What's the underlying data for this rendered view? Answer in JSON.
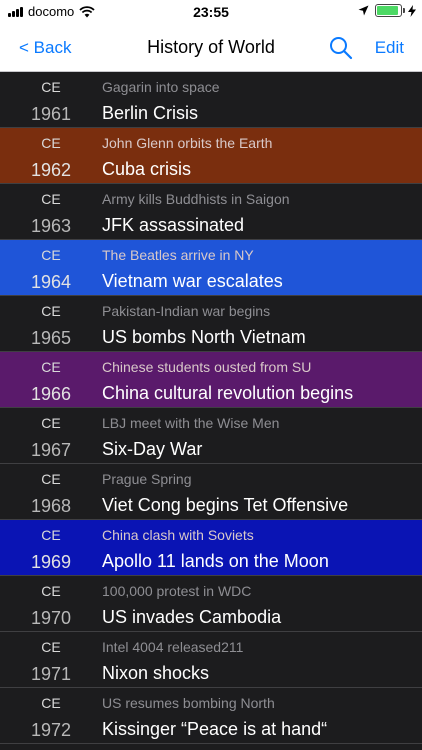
{
  "status_bar": {
    "carrier": "docomo",
    "time": "23:55",
    "battery_level": 0.9
  },
  "nav": {
    "back_label": "< Back",
    "title": "History of World",
    "edit_label": "Edit"
  },
  "rows": [
    {
      "era": "CE",
      "year": "1961",
      "subtitle": "Gagarin into space",
      "title": "Berlin Crisis",
      "bg": "#1c1c1e"
    },
    {
      "era": "CE",
      "year": "1962",
      "subtitle": "John Glenn orbits the Earth",
      "title": "Cuba crisis",
      "bg": "#7a2e0e"
    },
    {
      "era": "CE",
      "year": "1963",
      "subtitle": "Army kills Buddhists in Saigon",
      "title": "JFK assassinated",
      "bg": "#1c1c1e"
    },
    {
      "era": "CE",
      "year": "1964",
      "subtitle": "The Beatles arrive in NY",
      "title": "Vietnam war escalates",
      "bg": "#1f55d8"
    },
    {
      "era": "CE",
      "year": "1965",
      "subtitle": "Pakistan-Indian war begins",
      "title": "US bombs North Vietnam",
      "bg": "#1c1c1e"
    },
    {
      "era": "CE",
      "year": "1966",
      "subtitle": "Chinese students ousted from SU",
      "title": "China cultural revolution begins",
      "bg": "#5a1a6b"
    },
    {
      "era": "CE",
      "year": "1967",
      "subtitle": "LBJ meet with the Wise Men",
      "title": "Six-Day War",
      "bg": "#1c1c1e"
    },
    {
      "era": "CE",
      "year": "1968",
      "subtitle": "Prague Spring",
      "title": "Viet Cong begins Tet Offensive",
      "bg": "#1c1c1e"
    },
    {
      "era": "CE",
      "year": "1969",
      "subtitle": "China clash with Soviets",
      "title": "Apollo 11 lands on the Moon",
      "bg": "#0a14b4"
    },
    {
      "era": "CE",
      "year": "1970",
      "subtitle": "100,000 protest in WDC",
      "title": "US invades Cambodia",
      "bg": "#1c1c1e"
    },
    {
      "era": "CE",
      "year": "1971",
      "subtitle": "Intel 4004 released211",
      "title": "Nixon shocks",
      "bg": "#1c1c1e"
    },
    {
      "era": "CE",
      "year": "1972",
      "subtitle": "US resumes bombing North",
      "title": "Kissinger “Peace is at hand“",
      "bg": "#1c1c1e"
    }
  ],
  "colors": {
    "accent": "#0a7aff",
    "battery": "#4cd964",
    "list_bg": "#1c1c1e"
  },
  "icons": [
    "signal-bars-icon",
    "wifi-icon",
    "location-arrow-icon",
    "battery-icon",
    "charging-bolt-icon",
    "search-icon"
  ]
}
